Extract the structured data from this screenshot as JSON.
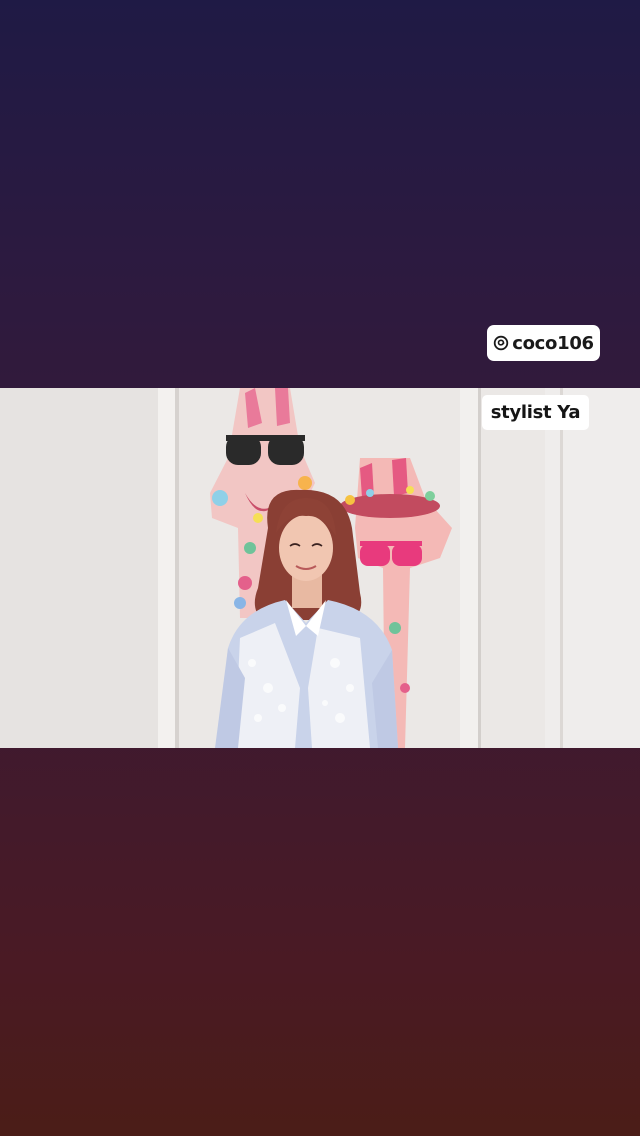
{
  "story": {
    "mention": {
      "icon": "threads-icon",
      "handle": "coco106"
    },
    "caption": "stylist Ya",
    "photo": {
      "subject": "woman-portrait-giraffe-mural"
    },
    "colors": {
      "background_top": "#1f1a45",
      "background_bottom": "#4b1d17",
      "sticker_bg": "#ffffff",
      "sticker_text": "#1a1a1a"
    }
  }
}
